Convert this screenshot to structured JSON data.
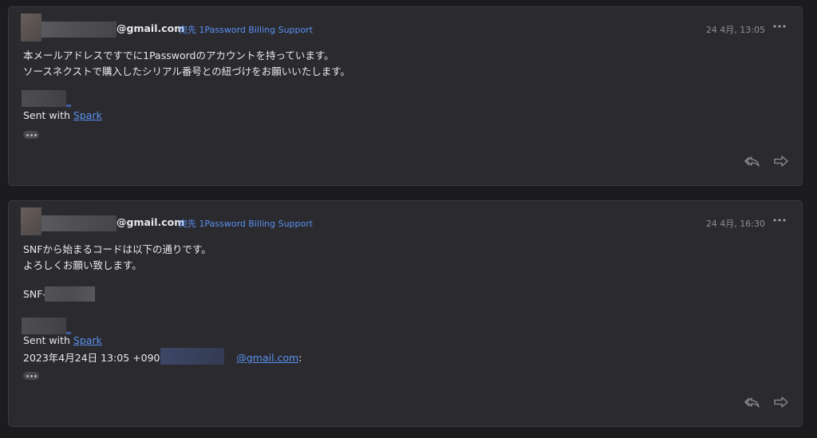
{
  "messages": [
    {
      "sender_address": "@gmail.com",
      "recipient": "宛先 1Password Billing Support",
      "date": "24 4月, 13:05",
      "body_lines": [
        "本メールアドレスですでに1Passwordのアカウントを持っています。",
        "ソースネクストで購入したシリアル番号との紐づけをお願いいたします。"
      ],
      "signature_prefix": "Sent with ",
      "signature_link": "Spark"
    },
    {
      "sender_address": "@gmail.com",
      "recipient": "宛先 1Password Billing Support",
      "date": "24 4月, 16:30",
      "body_lines": [
        "SNFから始まるコードは以下の通りです。",
        "よろしくお願い致します。"
      ],
      "code_prefix": "SNF-",
      "signature_prefix": "Sent with ",
      "signature_link": "Spark",
      "quote_header_prefix": "2023年4月24日 13:05 +0900, ",
      "quote_header_email": "@gmail.com",
      "quote_header_suffix": ":"
    }
  ],
  "icons": {
    "more": "more-horizontal-icon",
    "reply_all": "reply-all-icon",
    "forward": "forward-icon",
    "expand": "ellipsis-icon"
  }
}
